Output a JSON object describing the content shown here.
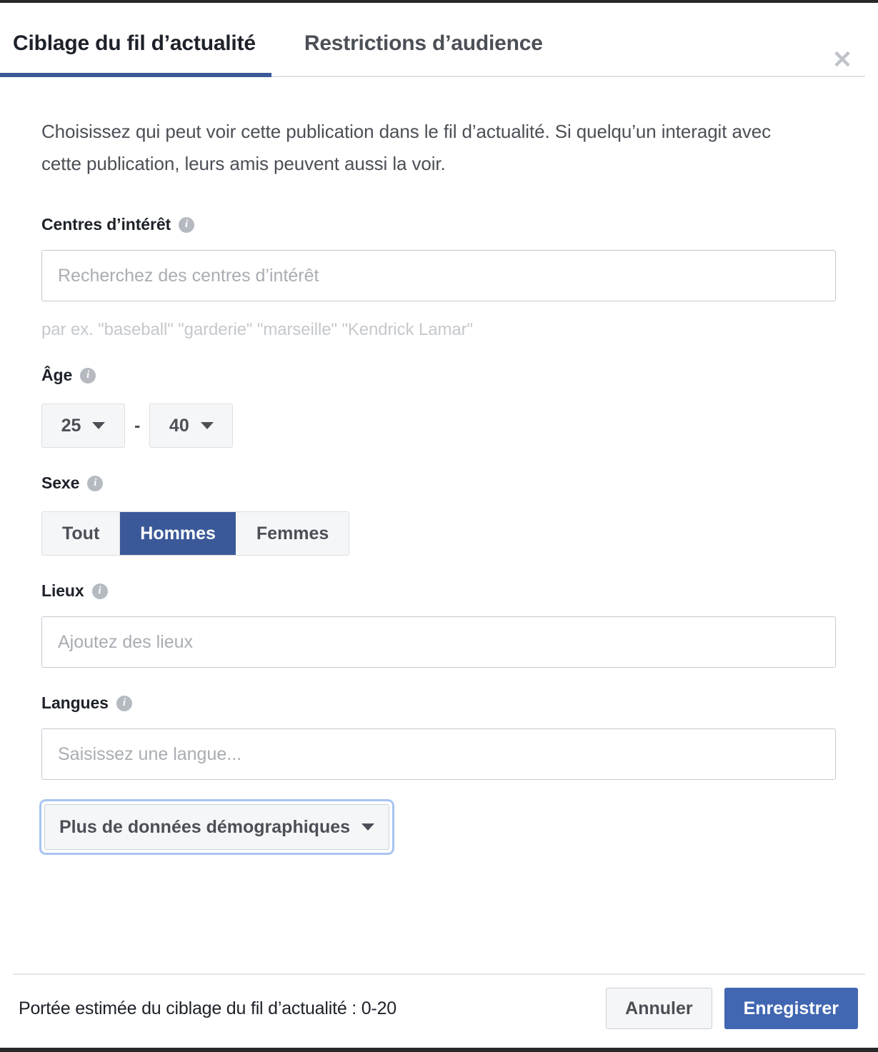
{
  "dialog": {
    "tabs": [
      {
        "label": "Ciblage du fil d’actualité",
        "active": true
      },
      {
        "label": "Restrictions d’audience",
        "active": false
      }
    ],
    "close_label": "✕",
    "intro": "Choisissez qui peut voir cette publication dans le fil d’actualité. Si quelqu’un interagit avec cette publication, leurs amis peuvent aussi la voir."
  },
  "interests": {
    "label": "Centres d’intérêt",
    "info_glyph": "i",
    "placeholder": "Recherchez des centres d’intérêt",
    "value": "",
    "hint": "par ex. \"baseball\" \"garderie\" \"marseille\" \"Kendrick Lamar\""
  },
  "age": {
    "label": "Âge",
    "info_glyph": "i",
    "min": "25",
    "max": "40",
    "separator": "-"
  },
  "gender": {
    "label": "Sexe",
    "info_glyph": "i",
    "options": [
      {
        "label": "Tout",
        "selected": false
      },
      {
        "label": "Hommes",
        "selected": true
      },
      {
        "label": "Femmes",
        "selected": false
      }
    ],
    "selected_color": "#3b5998"
  },
  "locations": {
    "label": "Lieux",
    "info_glyph": "i",
    "placeholder": "Ajoutez des lieux",
    "value": ""
  },
  "languages": {
    "label": "Langues",
    "info_glyph": "i",
    "placeholder": "Saisissez une langue...",
    "value": ""
  },
  "more_demographics": {
    "label": "Plus de données démographiques",
    "focus_ring_color": "#a8c4f0"
  },
  "footer": {
    "reach_text": "Portée estimée du ciblage du fil d’actualité : 0-20",
    "cancel_label": "Annuler",
    "save_label": "Enregistrer",
    "save_color": "#4267b2"
  }
}
